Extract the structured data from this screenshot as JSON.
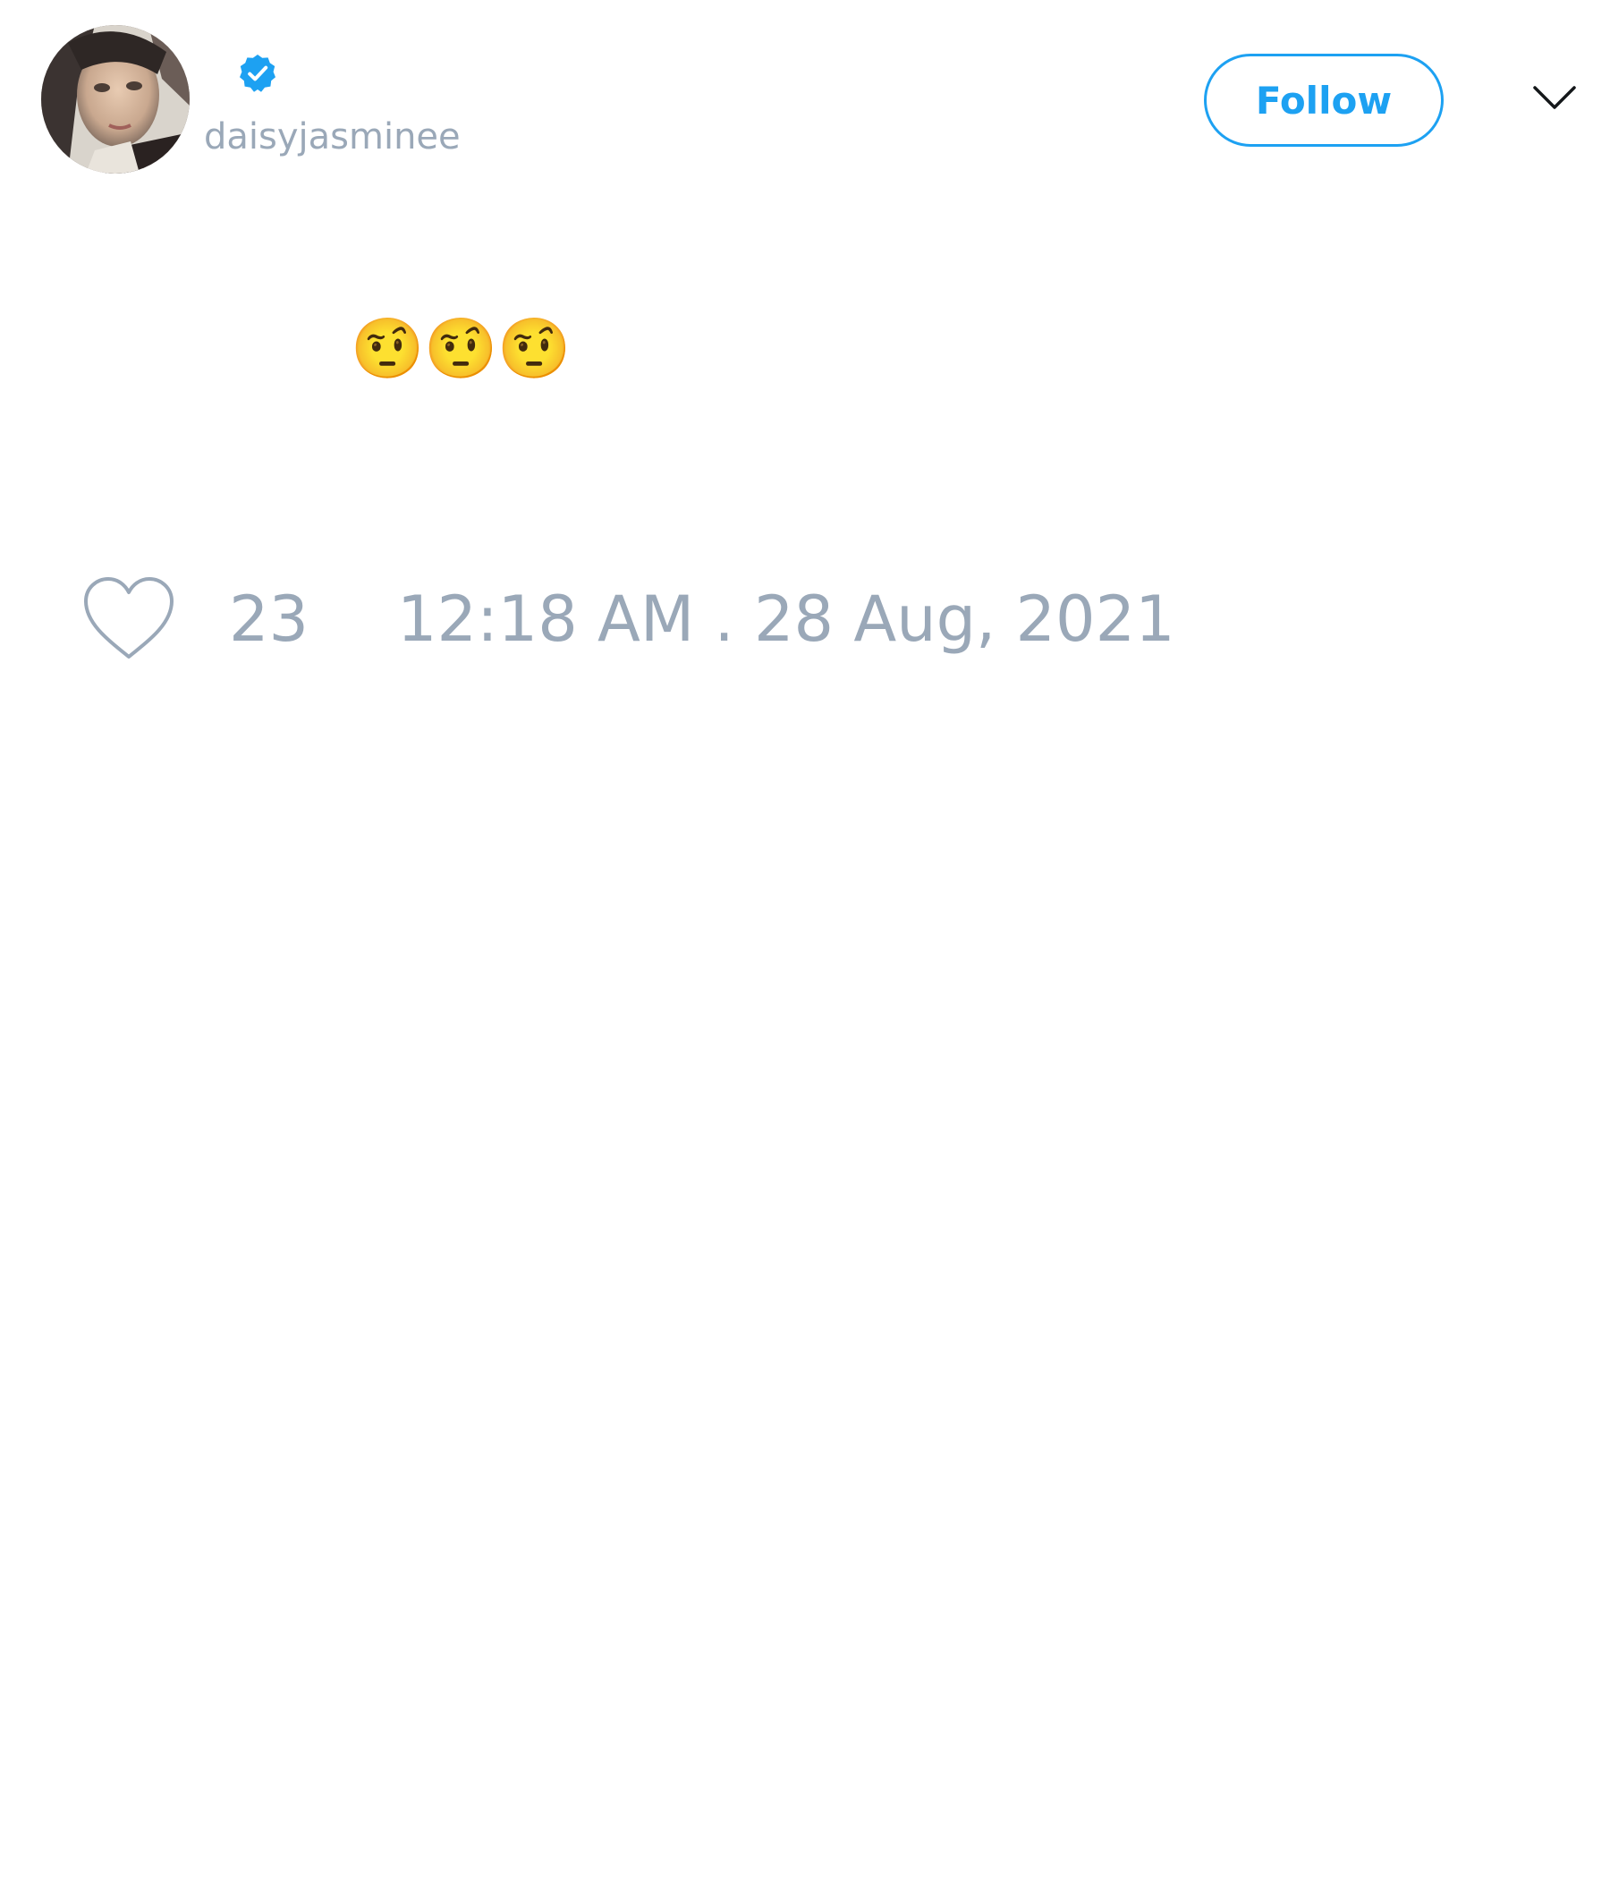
{
  "header": {
    "handle": "daisyjasminee",
    "follow_label": "Follow",
    "verified_icon": "verified-badge-icon",
    "menu_icon": "chevron-down-icon"
  },
  "tweet": {
    "text": "🤨🤨🤨",
    "likes": "23",
    "timestamp": "12:18 AM . 28 Aug, 2021"
  },
  "colors": {
    "accent": "#1da1f2",
    "muted_text": "#9aa8b8",
    "background": "#ffffff"
  }
}
